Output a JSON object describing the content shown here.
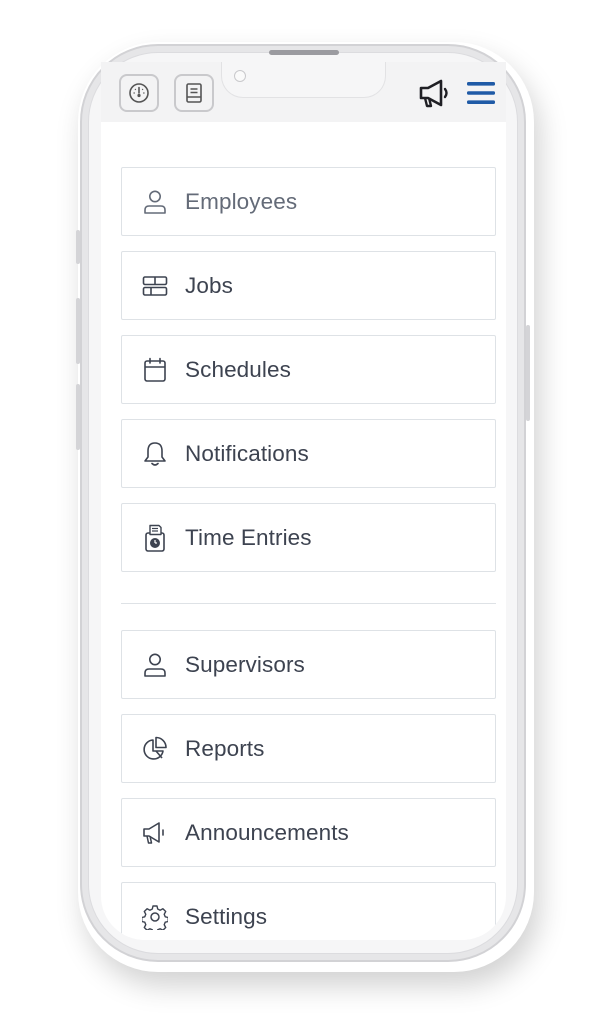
{
  "header": {
    "left_icons": [
      "dashboard-gauge-icon",
      "document-icon"
    ],
    "right_icons": [
      "megaphone-icon",
      "hamburger-menu-icon"
    ],
    "accent_color": "#1f5aa6"
  },
  "menu": {
    "group1": [
      {
        "label": "Employees",
        "icon": "user-icon"
      },
      {
        "label": "Jobs",
        "icon": "jobs-icon"
      },
      {
        "label": "Schedules",
        "icon": "calendar-icon"
      },
      {
        "label": "Notifications",
        "icon": "bell-icon"
      },
      {
        "label": "Time Entries",
        "icon": "time-clock-icon"
      }
    ],
    "group2": [
      {
        "label": "Supervisors",
        "icon": "user-icon"
      },
      {
        "label": "Reports",
        "icon": "pie-chart-icon"
      },
      {
        "label": "Announcements",
        "icon": "megaphone-icon"
      },
      {
        "label": "Settings",
        "icon": "gear-icon"
      }
    ]
  }
}
